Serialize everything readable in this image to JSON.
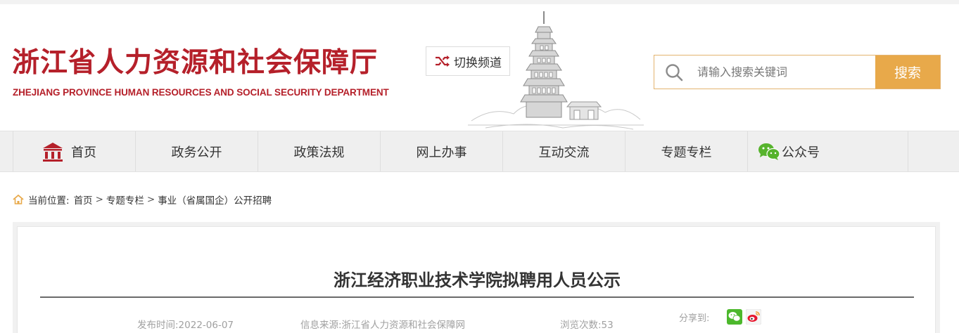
{
  "header": {
    "logo_cn": "浙江省人力资源和社会保障厅",
    "logo_en": "ZHEJIANG PROVINCE HUMAN RESOURCES AND SOCIAL SECURITY DEPARTMENT",
    "switch_label": "切换频道",
    "brand_color": "#b5202a"
  },
  "search": {
    "placeholder": "请输入搜索关键词",
    "button_label": "搜索",
    "accent_color": "#e8a94a"
  },
  "nav": {
    "items": [
      {
        "label": "首页",
        "icon": "home-icon"
      },
      {
        "label": "政务公开"
      },
      {
        "label": "政策法规"
      },
      {
        "label": "网上办事"
      },
      {
        "label": "互动交流"
      },
      {
        "label": "专题专栏"
      },
      {
        "label": "公众号",
        "icon": "wechat-icon"
      }
    ]
  },
  "breadcrumb": {
    "prefix": "当前位置:",
    "items": [
      "首页",
      "专题专栏",
      "事业（省属国企）公开招聘"
    ],
    "separator": ">"
  },
  "article": {
    "title": "浙江经济职业技术学院拟聘用人员公示",
    "publish_time": "发布时间:2022-06-07",
    "source": "信息来源:浙江省人力资源和社会保障网",
    "views": "浏览次数:53",
    "share_label": "分享到:",
    "share_icons": [
      "wechat-share-icon",
      "weibo-share-icon"
    ]
  }
}
